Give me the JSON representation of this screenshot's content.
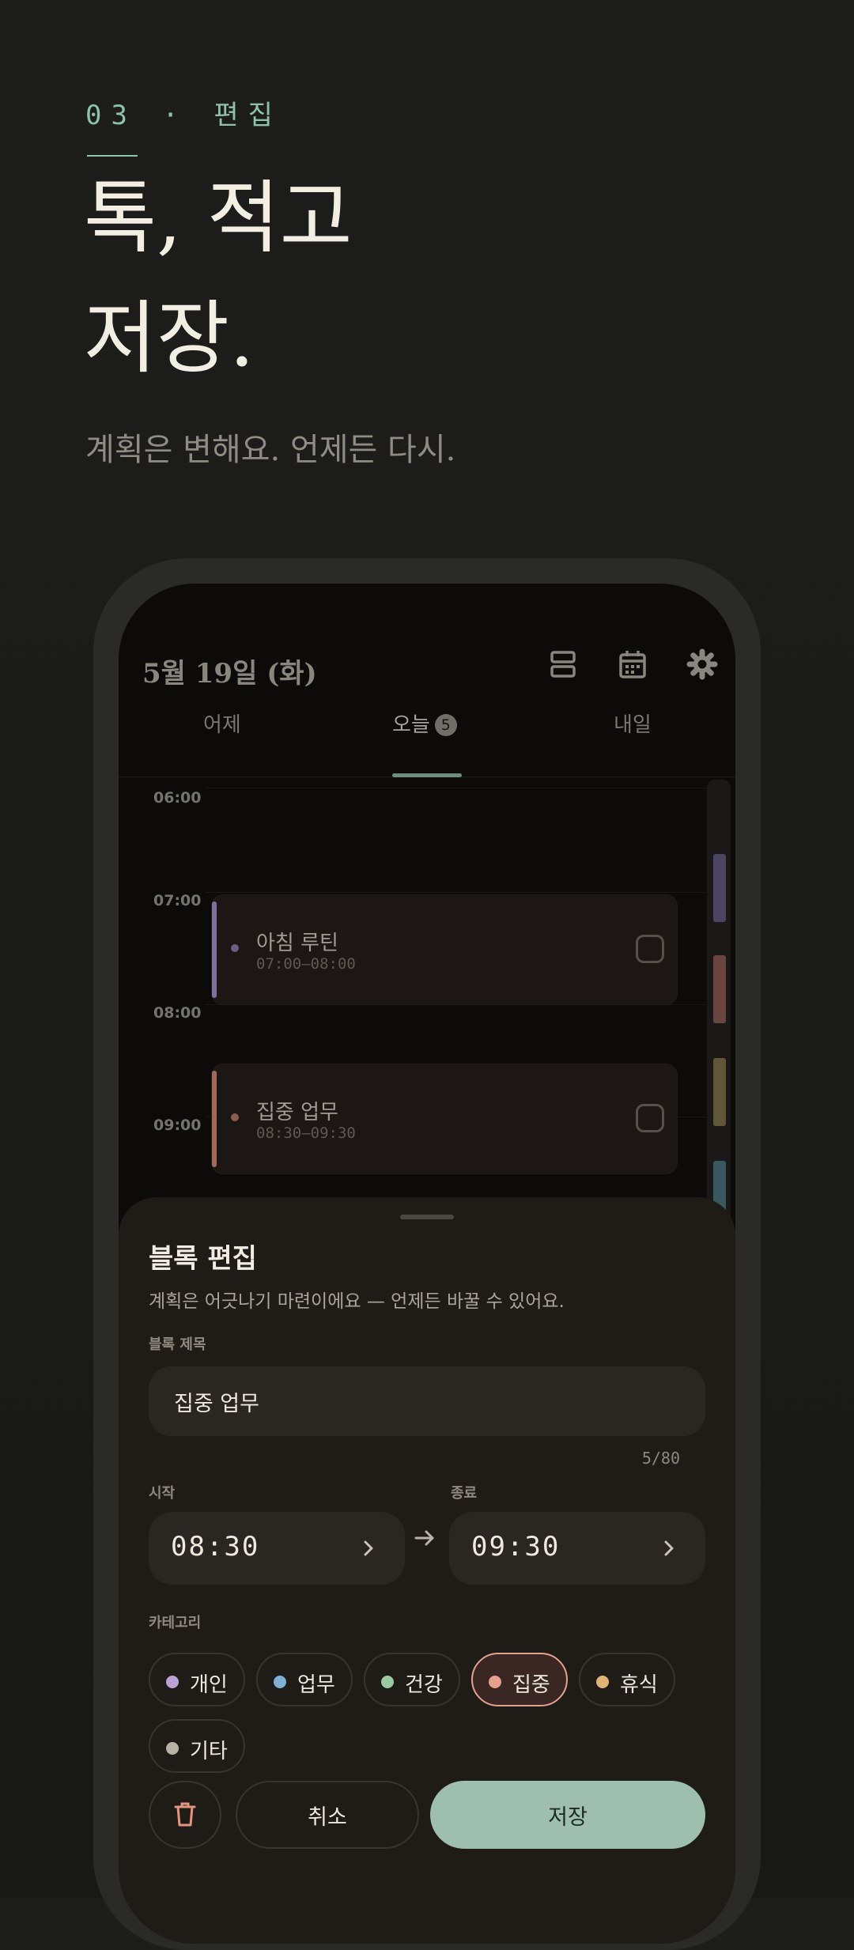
{
  "hero": {
    "kicker": "03 · 편집",
    "headline_line1": "톡, 적고",
    "headline_line2": "저장.",
    "subtitle": "계획은 변해요. 언제든 다시."
  },
  "app": {
    "date": "5월 19일 (화)",
    "icons": [
      "view-agenda-icon",
      "calendar-icon",
      "gear-icon"
    ],
    "tabs": [
      {
        "label": "어제"
      },
      {
        "label": "오늘",
        "badge": "5",
        "active": true
      },
      {
        "label": "내일"
      }
    ],
    "timeline": {
      "hours": [
        "06:00",
        "07:00",
        "08:00",
        "09:00"
      ],
      "blocks": [
        {
          "title": "아침 루틴",
          "time": "07:00–08:00",
          "color": "#7e729c",
          "checked": false
        },
        {
          "title": "집중 업무",
          "time": "08:30–09:30",
          "color": "#a06a58",
          "checked": false
        }
      ],
      "scroll_colors": [
        "#4a4560",
        "#6b4640",
        "#605638",
        "#3a5860"
      ]
    }
  },
  "sheet": {
    "title": "블록 편집",
    "description": "계획은 어긋나기 마련이에요 — 언제든 바꿀 수 있어요.",
    "title_field_label": "블록 제목",
    "title_value": "집중 업무",
    "char_count": "5/80",
    "start_label": "시작",
    "start_value": "08:30",
    "end_label": "종료",
    "end_value": "09:30",
    "category_label": "카테고리",
    "categories": [
      {
        "label": "개인",
        "color": "#b9a3d6"
      },
      {
        "label": "업무",
        "color": "#7fb0d6"
      },
      {
        "label": "건강",
        "color": "#9ccaa0"
      },
      {
        "label": "집중",
        "color": "#e8a08e",
        "selected": true
      },
      {
        "label": "휴식",
        "color": "#e0b276"
      },
      {
        "label": "기타",
        "color": "#b7b1a6"
      }
    ],
    "delete_icon": "trash-icon",
    "cancel_label": "취소",
    "save_label": "저장"
  },
  "colors": {
    "accent": "#8fc2ad",
    "save_button": "#9ebfb0",
    "delete_icon": "#e2947f"
  }
}
